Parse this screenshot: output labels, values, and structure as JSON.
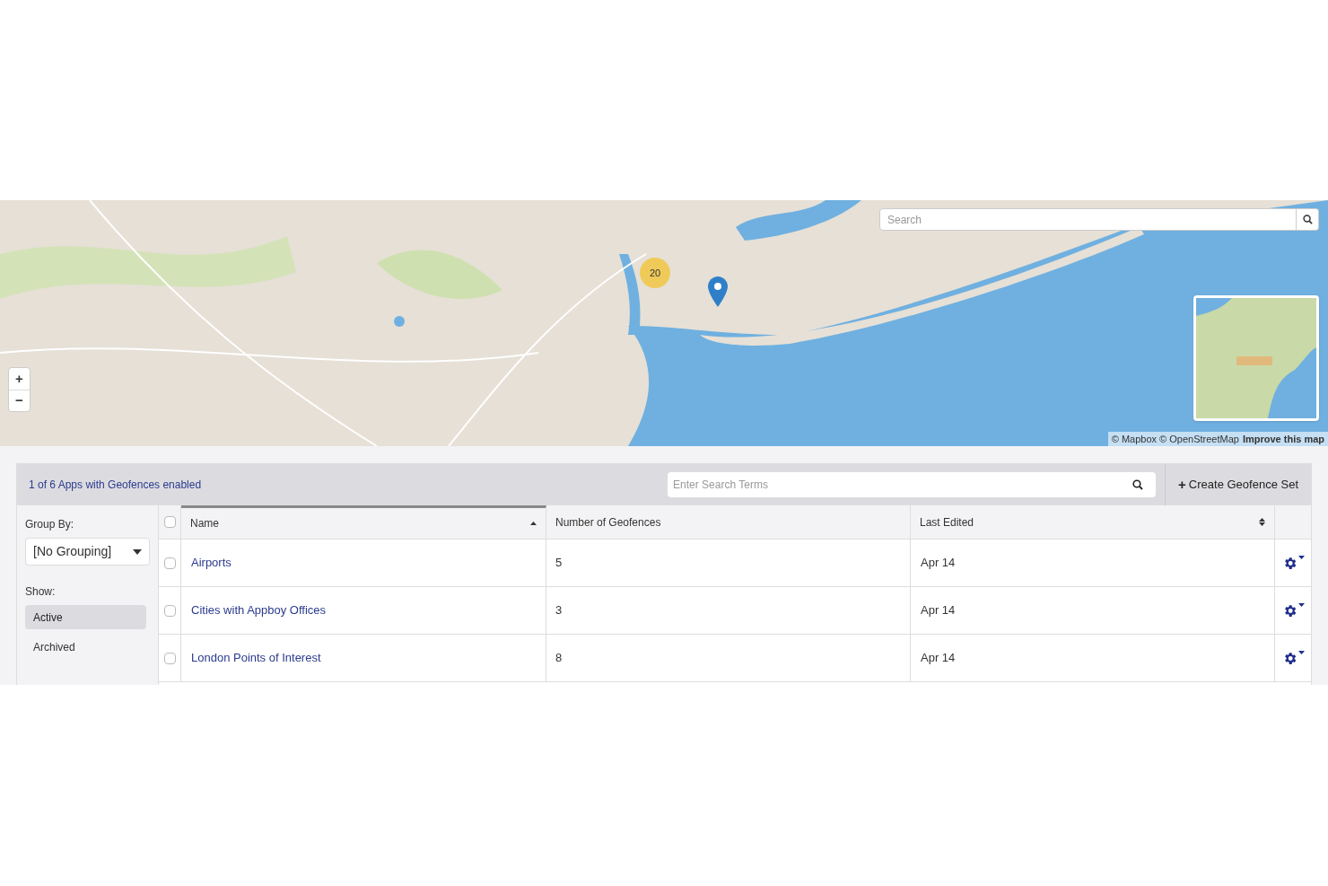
{
  "map": {
    "kind": "picture",
    "search": {
      "placeholder": "Search"
    },
    "zoom_controls": [
      "+",
      "−"
    ],
    "cluster": {
      "count": "20"
    },
    "attribution": {
      "text": "© Mapbox © OpenStreetMap",
      "link": "Improve this map"
    }
  },
  "panel": {
    "summary": "1 of 6 Apps with Geofences enabled",
    "search": {
      "placeholder": "Enter Search Terms"
    },
    "create_button": {
      "icon": "+",
      "label": "Create Geofence Set"
    }
  },
  "sidebar": {
    "group_by_label": "Group By:",
    "group_by_value": "[No Grouping]",
    "show_label": "Show:",
    "filters": [
      {
        "label": "Active",
        "selected": true
      },
      {
        "label": "Archived",
        "selected": false
      }
    ]
  },
  "table": {
    "select_all": {
      "checked": false
    },
    "columns": [
      {
        "label": "Name",
        "kind": "ascending"
      },
      {
        "label": "Number of Geofences",
        "kind": "plain"
      },
      {
        "label": "Last Edited",
        "kind": "sortable"
      }
    ],
    "rows": [
      {
        "checked": false,
        "name": "Airports",
        "count": "5",
        "edited": "Apr 14"
      },
      {
        "checked": false,
        "name": "Cities with Appboy Offices",
        "count": "3",
        "edited": "Apr 14"
      },
      {
        "checked": false,
        "name": "London Points of Interest",
        "count": "8",
        "edited": "Apr 14"
      }
    ]
  }
}
